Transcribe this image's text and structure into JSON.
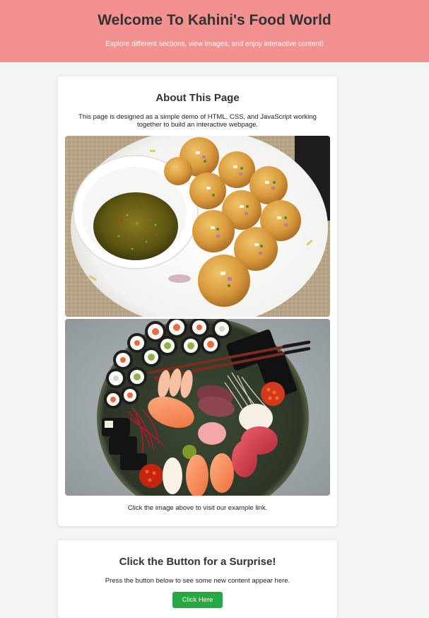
{
  "header": {
    "title": "Welcome To Kahini's Food World",
    "subtitle": "Explore different sections, view images, and enjoy interactive content!",
    "background_color": "#f39090"
  },
  "about": {
    "heading": "About This Page",
    "description": "This page is designed as a simple demo of HTML, CSS, and JavaScript working together to build an interactive webpage.",
    "images": [
      "pani-puri-photo",
      "sushi-platter-photo"
    ],
    "caption": "Click the image above to visit our example link."
  },
  "surprise": {
    "heading": "Click the Button for a Surprise!",
    "description": "Press the button below to see some new content appear here.",
    "button_label": "Click Here",
    "button_color": "#28a745"
  }
}
